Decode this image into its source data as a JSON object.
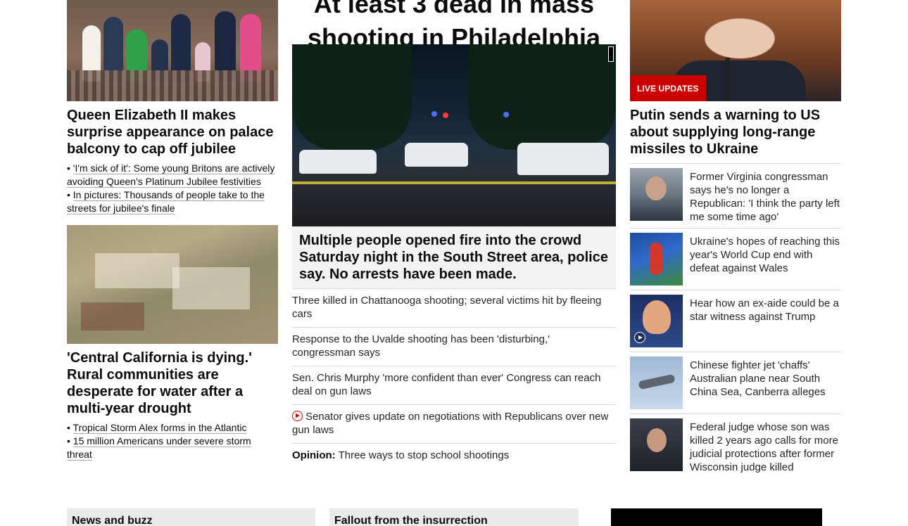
{
  "left": {
    "story1": {
      "headline": "Queen Elizabeth II makes surprise appearance on palace balcony to cap off jubilee",
      "links": [
        "'I'm sick of it': Some young Britons are actively avoiding Queen's Platinum Jubilee festivities",
        "In pictures: Thousands of people take to the streets for jubilee's finale"
      ]
    },
    "story2": {
      "headline": "'Central California is dying.' Rural communities are desperate for water after a multi-year drought",
      "links": [
        "Tropical Storm Alex forms in the Atlantic",
        "15 million Americans under severe storm threat"
      ]
    }
  },
  "center": {
    "title": "At least 3 dead in mass shooting in Philadelphia",
    "caption": "Multiple people opened fire into the crowd Saturday night in the South Street area, police say. No arrests have been made.",
    "list": [
      "Three killed in Chattanooga shooting; several victims hit by fleeing cars",
      "Response to the Uvalde shooting has been 'disturbing,' congressman says",
      "Sen. Chris Murphy 'more confident than ever' Congress can reach deal on gun laws",
      "Senator gives update on negotiations with Republicans over new gun laws"
    ],
    "opinion_label": "Opinion:",
    "opinion_text": "Three ways to stop school shootings"
  },
  "right": {
    "live_badge": "LIVE UPDATES",
    "headline": "Putin sends a warning to US about supplying long-range missiles to Ukraine",
    "items": [
      {
        "text": "Former Virginia congressman says he's no longer a Republican: 'I think the party left me some time ago'",
        "icon": "thumbnail"
      },
      {
        "text": "Ukraine's hopes of reaching this year's World Cup end with defeat against Wales",
        "icon": "thumbnail"
      },
      {
        "text": "Hear how an ex-aide could be a star witness against Trump",
        "icon": "play-icon"
      },
      {
        "text": "Chinese fighter jet 'chaffs' Australian plane near South China Sea, Canberra alleges",
        "icon": "thumbnail"
      },
      {
        "text": "Federal judge whose son was killed 2 years ago calls for more judicial protections after former Wisconsin judge killed",
        "icon": "thumbnail"
      }
    ]
  },
  "sections": {
    "news_buzz": "News and buzz",
    "insurrection": "Fallout from the insurrection"
  },
  "colors": {
    "accent": "#cc0000",
    "caption_bg": "#f2f2f2",
    "section_bg": "#eaeaea"
  }
}
